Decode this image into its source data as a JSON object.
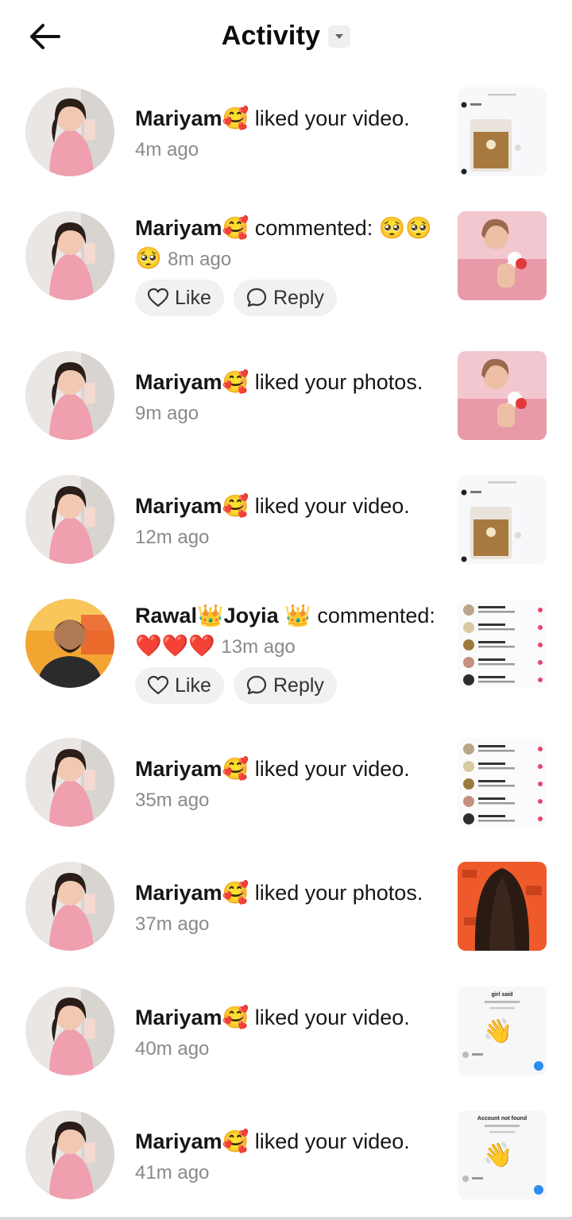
{
  "header": {
    "title": "Activity"
  },
  "items": [
    {
      "name": "Mariyam🥰",
      "action": "liked your video.",
      "time": "4m ago",
      "thumb": "chat-screenshot",
      "avatar": "pink"
    },
    {
      "name": "Mariyam🥰",
      "action": "commented: 🥺🥺🥺",
      "time": "8m ago",
      "thumb": "photo-pink",
      "avatar": "pink",
      "like": "Like",
      "reply": "Reply"
    },
    {
      "name": "Mariyam🥰",
      "action": "liked your photos.",
      "time": "9m ago",
      "thumb": "photo-pink",
      "avatar": "pink"
    },
    {
      "name": "Mariyam🥰",
      "action": "liked your video.",
      "time": "12m ago",
      "thumb": "chat-screenshot",
      "avatar": "pink"
    },
    {
      "name": "Rawal👑Joyia 👑",
      "action": "commented: ❤️❤️❤️",
      "time": "13m ago",
      "thumb": "list-screenshot",
      "avatar": "man",
      "like": "Like",
      "reply": "Reply"
    },
    {
      "name": "Mariyam🥰",
      "action": "liked your video.",
      "time": "35m ago",
      "thumb": "list-screenshot",
      "avatar": "pink"
    },
    {
      "name": "Mariyam🥰",
      "action": "liked your photos.",
      "time": "37m ago",
      "thumb": "photo-hair",
      "avatar": "pink"
    },
    {
      "name": "Mariyam🥰",
      "action": "liked your video.",
      "time": "40m ago",
      "thumb": "wave-screenshot",
      "avatar": "pink",
      "thumb_caption": "girl said"
    },
    {
      "name": "Mariyam🥰",
      "action": "liked your video.",
      "time": "41m ago",
      "thumb": "wave-screenshot",
      "avatar": "pink",
      "thumb_caption": "Account not found"
    }
  ],
  "colors": {
    "background": "#ffffff",
    "time": "#8a8a8a",
    "pill": "#f1f1f1"
  }
}
